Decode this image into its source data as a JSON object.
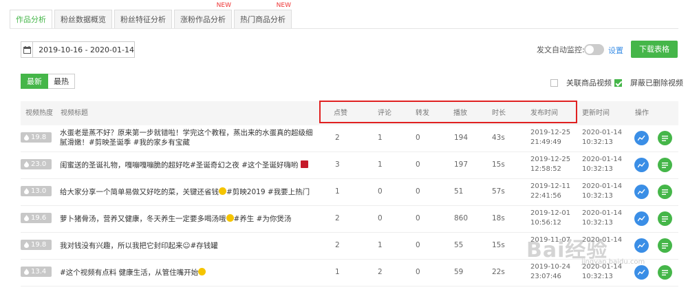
{
  "tabs": [
    {
      "label": "作品分析",
      "active": true,
      "badge": ""
    },
    {
      "label": "粉丝数据概览",
      "active": false,
      "badge": ""
    },
    {
      "label": "粉丝特征分析",
      "active": false,
      "badge": ""
    },
    {
      "label": "涨粉作品分析",
      "active": false,
      "badge": "NEW"
    },
    {
      "label": "热门商品分析",
      "active": false,
      "badge": "NEW"
    }
  ],
  "toolbar": {
    "date_range": "2019-10-16 - 2020-01-14",
    "auto_monitor_label": "发文自动监控:",
    "settings_label": "设置",
    "download_label": "下载表格"
  },
  "sort": {
    "latest": "最新",
    "hottest": "最热"
  },
  "filters": {
    "related_goods": "关联商品视频",
    "hide_deleted": "屏蔽已删除视频",
    "hide_deleted_checked": true
  },
  "columns": {
    "heat": "视频热度",
    "title": "视频标题",
    "likes": "点赞",
    "comments": "评论",
    "shares": "转发",
    "plays": "播放",
    "duration": "时长",
    "publish_time": "发布时间",
    "update_time": "更新时间",
    "actions": "操作"
  },
  "rows": [
    {
      "heat": "19.8",
      "title": "水蛋老是蒸不好？原来第一步就错啦！学完这个教程，蒸出来的水蛋真的超级细腻滑嫩！#剪映圣诞季 #我的家乡有宝藏",
      "likes": "2",
      "comments": "1",
      "shares": "0",
      "plays": "194",
      "duration": "43s",
      "pub_date": "2019-12-25",
      "pub_time": "21:49:49",
      "upd_date": "2020-01-14",
      "upd_time": "10:32:13"
    },
    {
      "heat": "23.0",
      "title": "闺蜜送的圣诞礼物，嘎嘣嘎嘣脆的超好吃#圣诞奇幻之夜 #这个圣诞好嗨哟",
      "likes": "3",
      "comments": "1",
      "shares": "0",
      "plays": "197",
      "duration": "15s",
      "pub_date": "2019-12-25",
      "pub_time": "12:58:52",
      "upd_date": "2020-01-14",
      "upd_time": "10:32:13"
    },
    {
      "heat": "13.0",
      "title": "给大家分享一个简单易做又好吃的菜，关键还省钱",
      "title_tail": "#剪映2019 #我要上热门",
      "likes": "1",
      "comments": "0",
      "shares": "0",
      "plays": "51",
      "duration": "57s",
      "pub_date": "2019-12-11",
      "pub_time": "22:41:56",
      "upd_date": "2020-01-14",
      "upd_time": "10:32:13"
    },
    {
      "heat": "19.6",
      "title": "萝卜猪骨汤，营养又健康，冬天养生一定要多喝汤哦",
      "title_tail": "#养生 #为你煲汤",
      "likes": "2",
      "comments": "0",
      "shares": "0",
      "plays": "860",
      "duration": "18s",
      "pub_date": "2019-12-01",
      "pub_time": "10:56:12",
      "upd_date": "2020-01-14",
      "upd_time": "10:32:13"
    },
    {
      "heat": "19.8",
      "title": "我对钱没有兴趣，所以我把它封印起来☺#存钱罐",
      "likes": "2",
      "comments": "1",
      "shares": "0",
      "plays": "55",
      "duration": "15s",
      "pub_date": "2019-11-07",
      "pub_time": "",
      "upd_date": "2020-01-14",
      "upd_time": ""
    },
    {
      "heat": "13.4",
      "title": "#这个视频有点料 健康生活，从管住嘴开始",
      "likes": "1",
      "comments": "2",
      "shares": "0",
      "plays": "59",
      "duration": "22s",
      "pub_date": "2019-10-24",
      "pub_time": "23:07:46",
      "upd_date": "2020-01-14",
      "upd_time": "10:32:13"
    }
  ],
  "watermark": {
    "text": "Bai经验",
    "sub": "jingyan.baidu.com"
  },
  "colors": {
    "accent": "#45b649",
    "link": "#3a8ee6",
    "highlight": "#e02020"
  }
}
